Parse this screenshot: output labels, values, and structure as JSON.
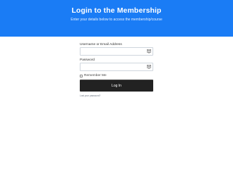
{
  "hero": {
    "title": "Login to the Membership",
    "subtitle": "Enter your details below to access the membership/course"
  },
  "form": {
    "username_label": "Username or Email Address",
    "username_value": "",
    "username_icon": "keyboard-icon",
    "password_label": "Password",
    "password_value": "",
    "password_icon": "keyboard-icon",
    "remember_label": "Remember Me",
    "remember_checked": false,
    "submit_label": "Log In",
    "lost_password_label": "Lost your password?"
  },
  "colors": {
    "hero_bg": "#1a7cf5",
    "button_bg": "#222222"
  }
}
